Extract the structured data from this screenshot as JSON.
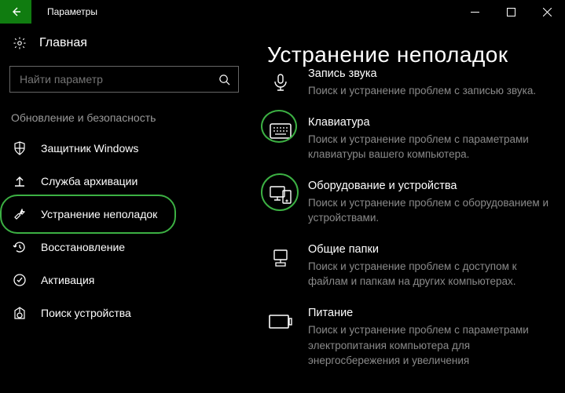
{
  "title": "Параметры",
  "home_label": "Главная",
  "search": {
    "placeholder": "Найти параметр"
  },
  "category": "Обновление и безопасность",
  "nav": [
    {
      "label": "Защитник Windows"
    },
    {
      "label": "Служба архивации"
    },
    {
      "label": "Устранение неполадок"
    },
    {
      "label": "Восстановление"
    },
    {
      "label": "Активация"
    },
    {
      "label": "Поиск устройства"
    }
  ],
  "heading": "Устранение неполадок",
  "items": [
    {
      "title": "Запись звука",
      "desc": "Поиск и устранение проблем с записью звука."
    },
    {
      "title": "Клавиатура",
      "desc": "Поиск и устранение проблем с параметрами клавиатуры вашего компьютера."
    },
    {
      "title": "Оборудование и устройства",
      "desc": "Поиск и устранение проблем с оборудованием и устройствами."
    },
    {
      "title": "Общие папки",
      "desc": "Поиск и устранение проблем с доступом к файлам и папкам на других компьютерах."
    },
    {
      "title": "Питание",
      "desc": "Поиск и устранение проблем с параметрами электропитания компьютера для энергосбережения и увеличения"
    }
  ]
}
